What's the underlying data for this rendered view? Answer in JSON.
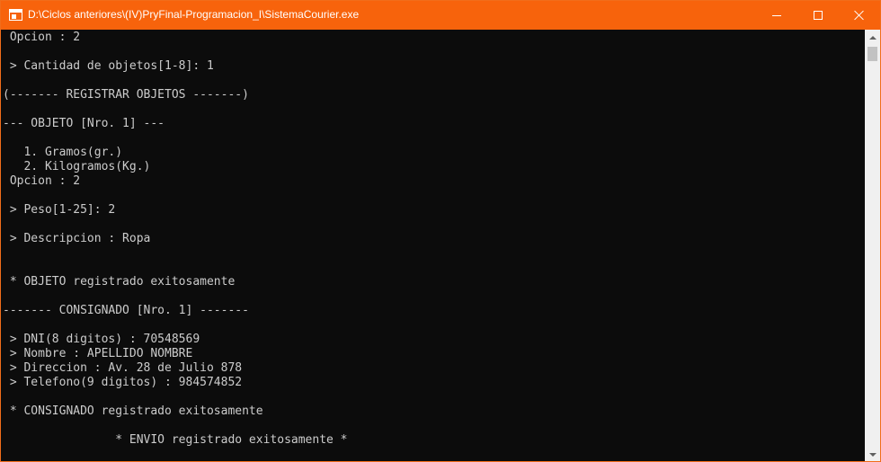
{
  "window": {
    "title": "D:\\Ciclos anteriores\\(IV)PryFinal-Programacion_I\\SistemaCourier.exe",
    "accent_color": "#f7630c",
    "icon": "console-app-icon",
    "controls": {
      "minimize_icon": "minimize-icon",
      "maximize_icon": "maximize-icon",
      "close_icon": "close-icon"
    }
  },
  "console": {
    "background": "#0c0c0c",
    "foreground": "#cccccc",
    "lines": [
      " Opcion : 2",
      "",
      " > Cantidad de objetos[1-8]: 1",
      "",
      "(------- REGISTRAR OBJETOS -------)",
      "",
      "--- OBJETO [Nro. 1] ---",
      "",
      "   1. Gramos(gr.)",
      "   2. Kilogramos(Kg.)",
      " Opcion : 2",
      "",
      " > Peso[1-25]: 2",
      "",
      " > Descripcion : Ropa",
      "",
      "",
      " * OBJETO registrado exitosamente",
      "",
      "------- CONSIGNADO [Nro. 1] -------",
      "",
      " > DNI(8 digitos) : 70548569",
      " > Nombre : APELLIDO NOMBRE",
      " > Direccion : Av. 28 de Julio 878",
      " > Telefono(9 digitos) : 984574852",
      "",
      " * CONSIGNADO registrado exitosamente",
      "",
      "                * ENVIO registrado exitosamente *"
    ]
  }
}
